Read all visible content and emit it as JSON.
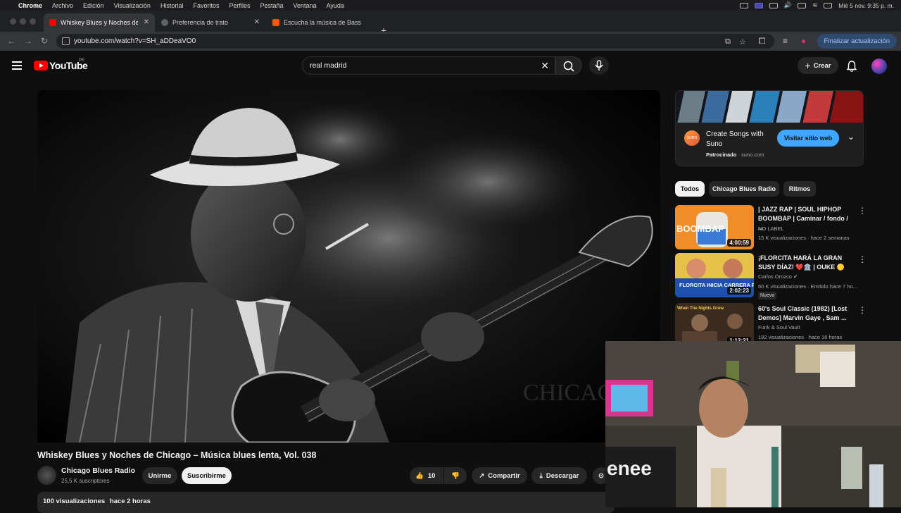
{
  "menubar": {
    "app": "Chrome",
    "items": [
      "Archivo",
      "Edición",
      "Visualización",
      "Historial",
      "Favoritos",
      "Perfiles",
      "Pestaña",
      "Ventana",
      "Ayuda"
    ],
    "clock": "Mié 5 nov.  9:35 p. m."
  },
  "tabs": [
    {
      "title": "Whiskey Blues y Noches de C",
      "favicon_color": "#ff0000"
    },
    {
      "title": "Preferencia de trato",
      "favicon_color": "#9aa0a6"
    },
    {
      "title": "Escucha la música de Bass Ja",
      "favicon_color": "#ff5500"
    }
  ],
  "address": {
    "url": "youtube.com/watch?v=SH_aDDeaVO0",
    "update_label": "Finalizar actualización"
  },
  "header": {
    "logo": "YouTube",
    "country": "PE",
    "search_query": "real madrid",
    "create_label": "Crear"
  },
  "video": {
    "title": "Whiskey Blues y Noches de Chicago – Música blues lenta, Vol. 038",
    "channel": "Chicago Blues Radio",
    "subscribers": "25,5 K suscriptores",
    "join_label": "Unirme",
    "subscribe_label": "Suscribirme",
    "likes": "10",
    "share_label": "Compartir",
    "download_label": "Descargar",
    "views": "100 visualizaciones",
    "posted": "hace 2 horas",
    "overlay_text": "CHICAGO BLUES"
  },
  "ad": {
    "title": "Create Songs with Suno",
    "logo_text": "SUNO",
    "sponsored_label": "Patrocinado",
    "domain": "suno.com",
    "visit_label": "Visitar sitio web"
  },
  "chips": [
    "Todos",
    "Chicago Blues Radio",
    "Ritmos"
  ],
  "related": [
    {
      "title": "| JAZZ RAP | SOUL HIPHOP BOOMBAP | Caminar / fondo / ...",
      "channel": "NO LABEL",
      "meta": "15 K visualizaciones · hace 2 semanas",
      "duration": "4:00:59",
      "thumb_text": "BOOMBAP"
    },
    {
      "title": "¡FLORCITA HARÁ LA GRAN SUSY DÍAZ! ❤️🏛️ | OUKE 🟡",
      "channel": "Carlos Orozco",
      "meta": "60 K visualizaciones · Emitido hace 7 ho...",
      "duration": "2:02:23",
      "badge": "Nuevo",
      "thumb_text": "FLORCITA INICIA CARRERA POR SU"
    },
    {
      "title": "60's Soul Classic (1982) [Lost Demos] Marvin Gaye , Sam ...",
      "channel": "Funk & Soul Vault",
      "meta": "192 visualizaciones · hace 16 horas",
      "duration": "1:12:21",
      "thumb_text": "When The Nights Grow"
    }
  ]
}
